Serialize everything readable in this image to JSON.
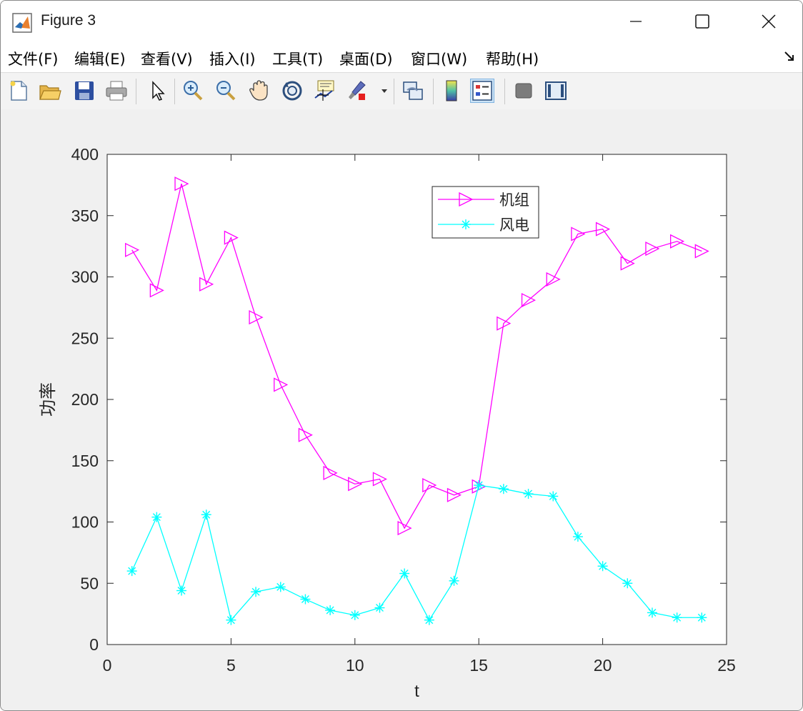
{
  "window": {
    "title": "Figure 3",
    "controls": [
      "minimize-icon",
      "maximize-icon",
      "close-icon"
    ]
  },
  "menu": {
    "items": [
      {
        "label": "文件(F)"
      },
      {
        "label": "编辑(E)"
      },
      {
        "label": "查看(V)"
      },
      {
        "label": "插入(I)"
      },
      {
        "label": "工具(T)"
      },
      {
        "label": "桌面(D)"
      },
      {
        "label": "窗口(W)"
      },
      {
        "label": "帮助(H)"
      }
    ]
  },
  "toolbar": {
    "buttons": [
      {
        "icon": "new-figure-icon"
      },
      {
        "icon": "open-file-icon"
      },
      {
        "icon": "save-icon"
      },
      {
        "icon": "print-icon"
      },
      {
        "icon": "select-arrow-icon"
      },
      {
        "icon": "zoom-in-icon"
      },
      {
        "icon": "zoom-out-icon"
      },
      {
        "icon": "pan-hand-icon"
      },
      {
        "icon": "rotate-3d-icon"
      },
      {
        "icon": "data-cursor-icon"
      },
      {
        "icon": "brush-icon"
      },
      {
        "icon": "link-plot-icon"
      },
      {
        "icon": "colorbar-icon"
      },
      {
        "icon": "legend-icon"
      },
      {
        "icon": "hide-plot-tools-icon"
      },
      {
        "icon": "show-plot-tools-icon"
      }
    ]
  },
  "chart_data": {
    "type": "line",
    "title": "",
    "xlabel": "t",
    "ylabel": "功率",
    "xlim": [
      0,
      25
    ],
    "ylim": [
      0,
      400
    ],
    "xticks": [
      0,
      5,
      10,
      15,
      20,
      25
    ],
    "yticks": [
      0,
      50,
      100,
      150,
      200,
      250,
      300,
      350,
      400
    ],
    "grid": false,
    "legend_position": "top-right",
    "x": [
      1,
      2,
      3,
      4,
      5,
      6,
      7,
      8,
      9,
      10,
      11,
      12,
      13,
      14,
      15,
      16,
      17,
      18,
      19,
      20,
      21,
      22,
      23,
      24
    ],
    "series": [
      {
        "name": "机组",
        "color": "#ff00ff",
        "marker": "triangle-right",
        "values": [
          322,
          289,
          376,
          294,
          332,
          267,
          212,
          171,
          140,
          131,
          135,
          95,
          130,
          122,
          129,
          262,
          281,
          298,
          335,
          339,
          311,
          323,
          329,
          321
        ]
      },
      {
        "name": "风电",
        "color": "#00ffff",
        "marker": "asterisk",
        "values": [
          60,
          104,
          44,
          106,
          20,
          43,
          47,
          37,
          28,
          24,
          30,
          58,
          20,
          52,
          130,
          127,
          123,
          121,
          88,
          64,
          50,
          26,
          22,
          22
        ]
      }
    ]
  }
}
